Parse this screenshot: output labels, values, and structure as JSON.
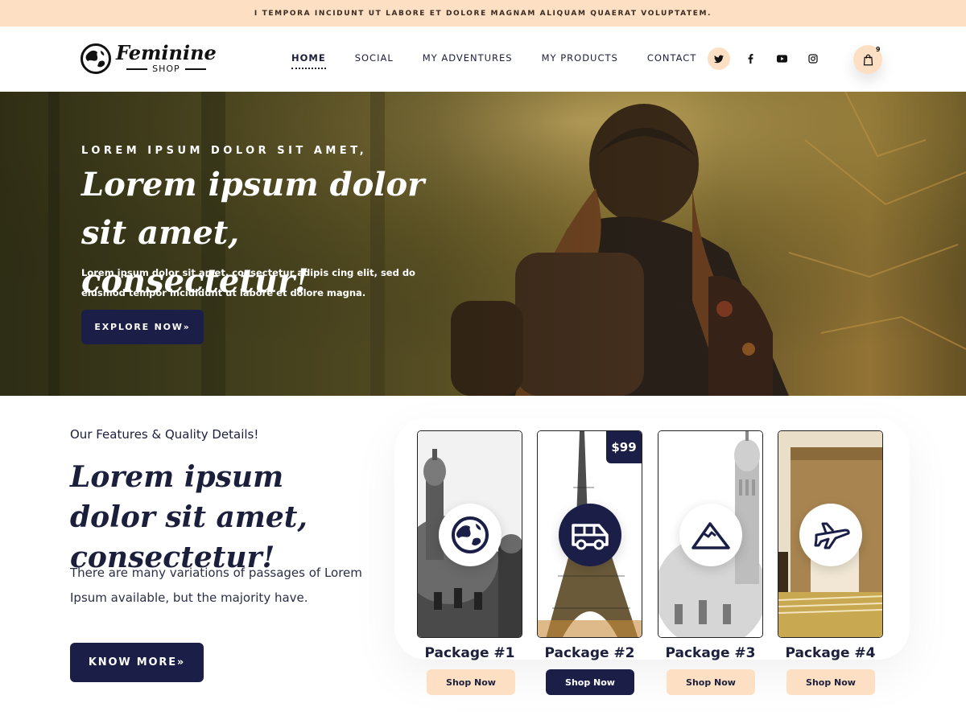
{
  "topbar": {
    "text": "I TEMPORA INCIDUNT UT LABORE ET DOLORE MAGNAM ALIQUAM QUAERAT VOLUPTATEM."
  },
  "logo": {
    "name": "Feminine",
    "sub": "SHOP"
  },
  "nav": [
    {
      "label": "HOME",
      "active": true
    },
    {
      "label": "SOCIAL"
    },
    {
      "label": "MY ADVENTURES"
    },
    {
      "label": "MY PRODUCTS"
    },
    {
      "label": "CONTACT"
    }
  ],
  "social": [
    "twitter-icon",
    "facebook-icon",
    "youtube-icon",
    "instagram-icon"
  ],
  "cart": {
    "count": "9"
  },
  "hero": {
    "kicker": "LOREM IPSUM DOLOR SIT AMET,",
    "title": "Lorem ipsum dolor sit amet, consectetur!",
    "text": "Lorem ipsum dolor sit amet, consectetur adipis cing elit, sed do eiusmod tempor  incididunt ut labore et dolore magna.",
    "button": "EXPLORE NOW»"
  },
  "features": {
    "kicker": "Our Features & Quality Details!",
    "title": "Lorem ipsum dolor sit amet, consectetur!",
    "text": "There are many variations of passages of Lorem Ipsum available, but the majority have.",
    "button": "KNOW MORE»"
  },
  "packages": [
    {
      "name": "Package #1",
      "button": "Shop Now",
      "icon": "globe-icon"
    },
    {
      "name": "Package #2",
      "button": "Shop Now",
      "icon": "van-icon",
      "price": "$99"
    },
    {
      "name": "Package #3",
      "button": "Shop Now",
      "icon": "mountain-icon"
    },
    {
      "name": "Package #4",
      "button": "Shop Now",
      "icon": "airplane-icon"
    }
  ],
  "colors": {
    "peach": "#fde0c4",
    "navy": "#1b1f47",
    "text": "#1b1f3b"
  }
}
